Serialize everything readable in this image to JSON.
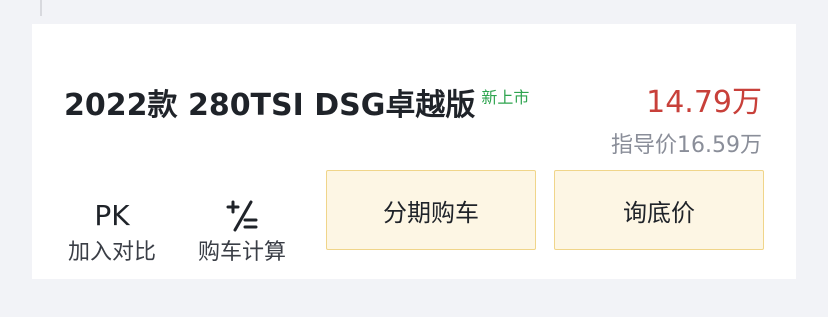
{
  "car": {
    "title": "2022款 280TSI DSG卓越版",
    "tag": "新上市",
    "price": "14.79万",
    "guide_price": "指导价16.59万"
  },
  "actions": {
    "pk_icon": "PK",
    "pk_label": "加入对比",
    "calc_icon": "calculator-icon",
    "calc_label": "购车计算"
  },
  "buttons": {
    "installment": "分期购车",
    "inquiry": "询底价"
  },
  "colors": {
    "price": "#c8403a",
    "tag": "#2ea44f",
    "button_bg": "#fdf6e4",
    "button_border": "#f0d58a"
  }
}
